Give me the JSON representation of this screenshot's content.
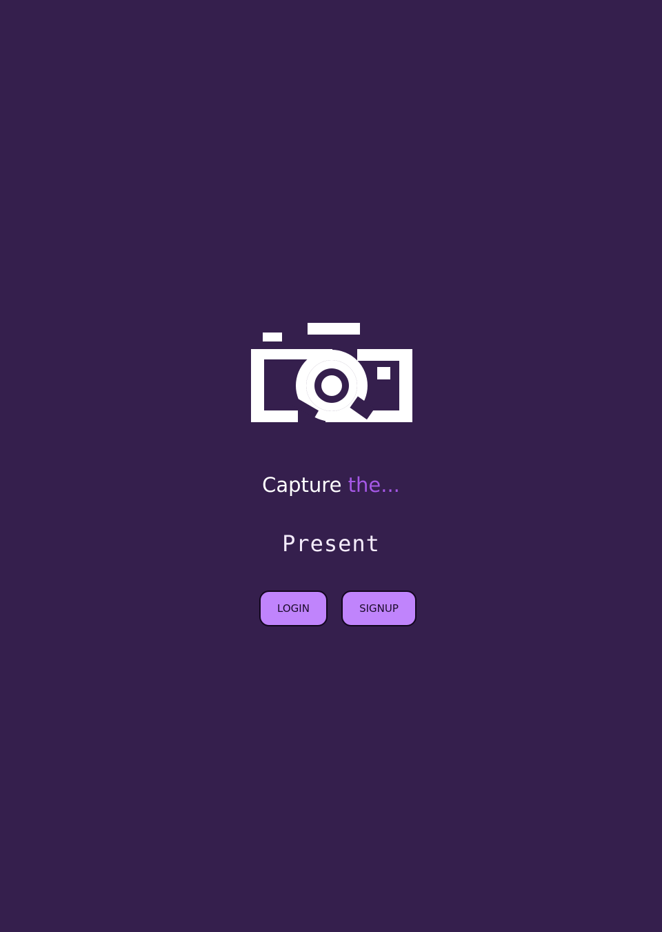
{
  "hero": {
    "logo_icon": "camera-icon",
    "tagline_prefix": "Capture",
    "tagline_accent": "the...",
    "rotating_word": "Present"
  },
  "actions": {
    "login_label": "LOGIN",
    "signup_label": "SIGNUP"
  },
  "colors": {
    "background": "#351f4d",
    "accent": "#a558e6",
    "button": "#c084fc",
    "text": "#ffffff"
  }
}
